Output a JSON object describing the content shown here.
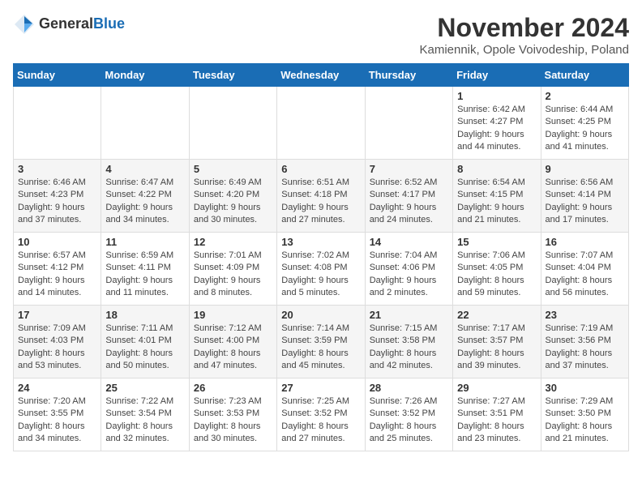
{
  "logo": {
    "general": "General",
    "blue": "Blue"
  },
  "title": "November 2024",
  "location": "Kamiennik, Opole Voivodeship, Poland",
  "days_of_week": [
    "Sunday",
    "Monday",
    "Tuesday",
    "Wednesday",
    "Thursday",
    "Friday",
    "Saturday"
  ],
  "weeks": [
    [
      {
        "day": "",
        "detail": ""
      },
      {
        "day": "",
        "detail": ""
      },
      {
        "day": "",
        "detail": ""
      },
      {
        "day": "",
        "detail": ""
      },
      {
        "day": "",
        "detail": ""
      },
      {
        "day": "1",
        "detail": "Sunrise: 6:42 AM\nSunset: 4:27 PM\nDaylight: 9 hours and 44 minutes."
      },
      {
        "day": "2",
        "detail": "Sunrise: 6:44 AM\nSunset: 4:25 PM\nDaylight: 9 hours and 41 minutes."
      }
    ],
    [
      {
        "day": "3",
        "detail": "Sunrise: 6:46 AM\nSunset: 4:23 PM\nDaylight: 9 hours and 37 minutes."
      },
      {
        "day": "4",
        "detail": "Sunrise: 6:47 AM\nSunset: 4:22 PM\nDaylight: 9 hours and 34 minutes."
      },
      {
        "day": "5",
        "detail": "Sunrise: 6:49 AM\nSunset: 4:20 PM\nDaylight: 9 hours and 30 minutes."
      },
      {
        "day": "6",
        "detail": "Sunrise: 6:51 AM\nSunset: 4:18 PM\nDaylight: 9 hours and 27 minutes."
      },
      {
        "day": "7",
        "detail": "Sunrise: 6:52 AM\nSunset: 4:17 PM\nDaylight: 9 hours and 24 minutes."
      },
      {
        "day": "8",
        "detail": "Sunrise: 6:54 AM\nSunset: 4:15 PM\nDaylight: 9 hours and 21 minutes."
      },
      {
        "day": "9",
        "detail": "Sunrise: 6:56 AM\nSunset: 4:14 PM\nDaylight: 9 hours and 17 minutes."
      }
    ],
    [
      {
        "day": "10",
        "detail": "Sunrise: 6:57 AM\nSunset: 4:12 PM\nDaylight: 9 hours and 14 minutes."
      },
      {
        "day": "11",
        "detail": "Sunrise: 6:59 AM\nSunset: 4:11 PM\nDaylight: 9 hours and 11 minutes."
      },
      {
        "day": "12",
        "detail": "Sunrise: 7:01 AM\nSunset: 4:09 PM\nDaylight: 9 hours and 8 minutes."
      },
      {
        "day": "13",
        "detail": "Sunrise: 7:02 AM\nSunset: 4:08 PM\nDaylight: 9 hours and 5 minutes."
      },
      {
        "day": "14",
        "detail": "Sunrise: 7:04 AM\nSunset: 4:06 PM\nDaylight: 9 hours and 2 minutes."
      },
      {
        "day": "15",
        "detail": "Sunrise: 7:06 AM\nSunset: 4:05 PM\nDaylight: 8 hours and 59 minutes."
      },
      {
        "day": "16",
        "detail": "Sunrise: 7:07 AM\nSunset: 4:04 PM\nDaylight: 8 hours and 56 minutes."
      }
    ],
    [
      {
        "day": "17",
        "detail": "Sunrise: 7:09 AM\nSunset: 4:03 PM\nDaylight: 8 hours and 53 minutes."
      },
      {
        "day": "18",
        "detail": "Sunrise: 7:11 AM\nSunset: 4:01 PM\nDaylight: 8 hours and 50 minutes."
      },
      {
        "day": "19",
        "detail": "Sunrise: 7:12 AM\nSunset: 4:00 PM\nDaylight: 8 hours and 47 minutes."
      },
      {
        "day": "20",
        "detail": "Sunrise: 7:14 AM\nSunset: 3:59 PM\nDaylight: 8 hours and 45 minutes."
      },
      {
        "day": "21",
        "detail": "Sunrise: 7:15 AM\nSunset: 3:58 PM\nDaylight: 8 hours and 42 minutes."
      },
      {
        "day": "22",
        "detail": "Sunrise: 7:17 AM\nSunset: 3:57 PM\nDaylight: 8 hours and 39 minutes."
      },
      {
        "day": "23",
        "detail": "Sunrise: 7:19 AM\nSunset: 3:56 PM\nDaylight: 8 hours and 37 minutes."
      }
    ],
    [
      {
        "day": "24",
        "detail": "Sunrise: 7:20 AM\nSunset: 3:55 PM\nDaylight: 8 hours and 34 minutes."
      },
      {
        "day": "25",
        "detail": "Sunrise: 7:22 AM\nSunset: 3:54 PM\nDaylight: 8 hours and 32 minutes."
      },
      {
        "day": "26",
        "detail": "Sunrise: 7:23 AM\nSunset: 3:53 PM\nDaylight: 8 hours and 30 minutes."
      },
      {
        "day": "27",
        "detail": "Sunrise: 7:25 AM\nSunset: 3:52 PM\nDaylight: 8 hours and 27 minutes."
      },
      {
        "day": "28",
        "detail": "Sunrise: 7:26 AM\nSunset: 3:52 PM\nDaylight: 8 hours and 25 minutes."
      },
      {
        "day": "29",
        "detail": "Sunrise: 7:27 AM\nSunset: 3:51 PM\nDaylight: 8 hours and 23 minutes."
      },
      {
        "day": "30",
        "detail": "Sunrise: 7:29 AM\nSunset: 3:50 PM\nDaylight: 8 hours and 21 minutes."
      }
    ]
  ]
}
